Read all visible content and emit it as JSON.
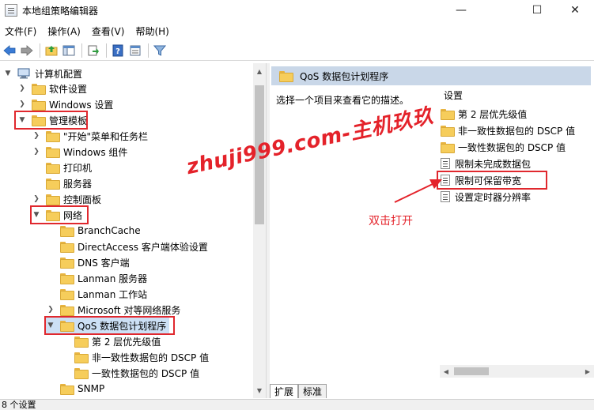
{
  "window": {
    "title": "本地组策略编辑器",
    "minimize": "—",
    "maximize": "☐",
    "close": "✕"
  },
  "menu": [
    "文件(F)",
    "操作(A)",
    "查看(V)",
    "帮助(H)"
  ],
  "tree": {
    "root": "计算机配置",
    "software_settings": "软件设置",
    "windows_settings": "Windows 设置",
    "admin_templates": "管理模板",
    "start_menu": "\"开始\"菜单和任务栏",
    "windows_components": "Windows 组件",
    "printers": "打印机",
    "server": "服务器",
    "control_panel": "控制面板",
    "network": "网络",
    "branchcache": "BranchCache",
    "directaccess": "DirectAccess 客户端体验设置",
    "dns_client": "DNS 客户端",
    "lanman_server": "Lanman 服务器",
    "lanman_workstation": "Lanman 工作站",
    "ms_p2p": "Microsoft 对等网络服务",
    "qos": "QoS 数据包计划程序",
    "qos_layer2": "第 2 层优先级值",
    "qos_nonconform": "非一致性数据包的 DSCP 值",
    "qos_conform": "一致性数据包的 DSCP 值",
    "snmp": "SNMP"
  },
  "right": {
    "header": "QoS 数据包计划程序",
    "description": "选择一个项目来查看它的描述。",
    "column": "设置",
    "items": [
      "第 2 层优先级值",
      "非一致性数据包的 DSCP 值",
      "一致性数据包的 DSCP 值",
      "限制未完成数据包",
      "限制可保留带宽",
      "设置定时器分辨率"
    ]
  },
  "tabs": [
    "扩展",
    "标准"
  ],
  "status": "8 个设置",
  "watermark": "zhuji999.com-主机玖玖",
  "annotation": "双击打开",
  "colors": {
    "highlight": "#e0282e",
    "header_bg": "#c9d7e8",
    "folder": "#f6cd5b"
  }
}
